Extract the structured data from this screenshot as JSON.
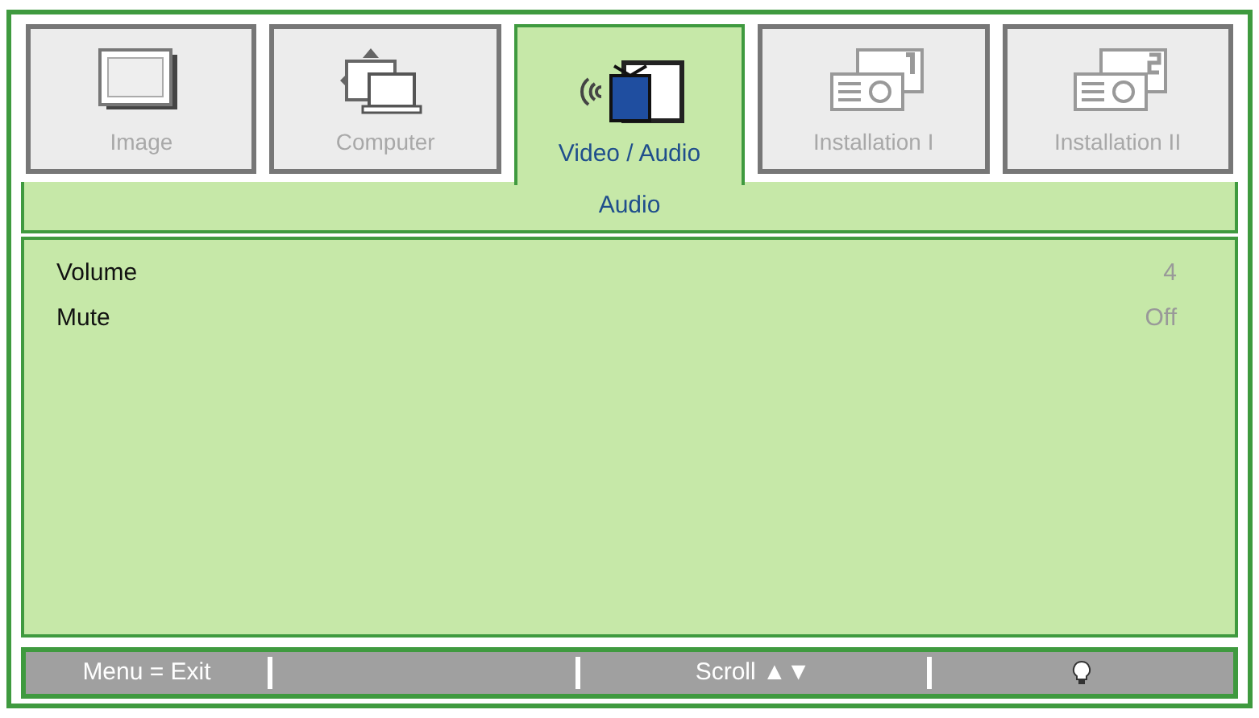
{
  "tabs": [
    {
      "label": "Image",
      "selected": false
    },
    {
      "label": "Computer",
      "selected": false
    },
    {
      "label": "Video / Audio",
      "selected": true
    },
    {
      "label": "Installation I",
      "selected": false
    },
    {
      "label": "Installation II",
      "selected": false
    }
  ],
  "submenu": {
    "title": "Audio"
  },
  "settings": [
    {
      "label": "Volume",
      "value": "4"
    },
    {
      "label": "Mute",
      "value": "Off"
    }
  ],
  "status_bar": {
    "hint": "Menu = Exit",
    "scroll": "Scroll ▲▼"
  }
}
